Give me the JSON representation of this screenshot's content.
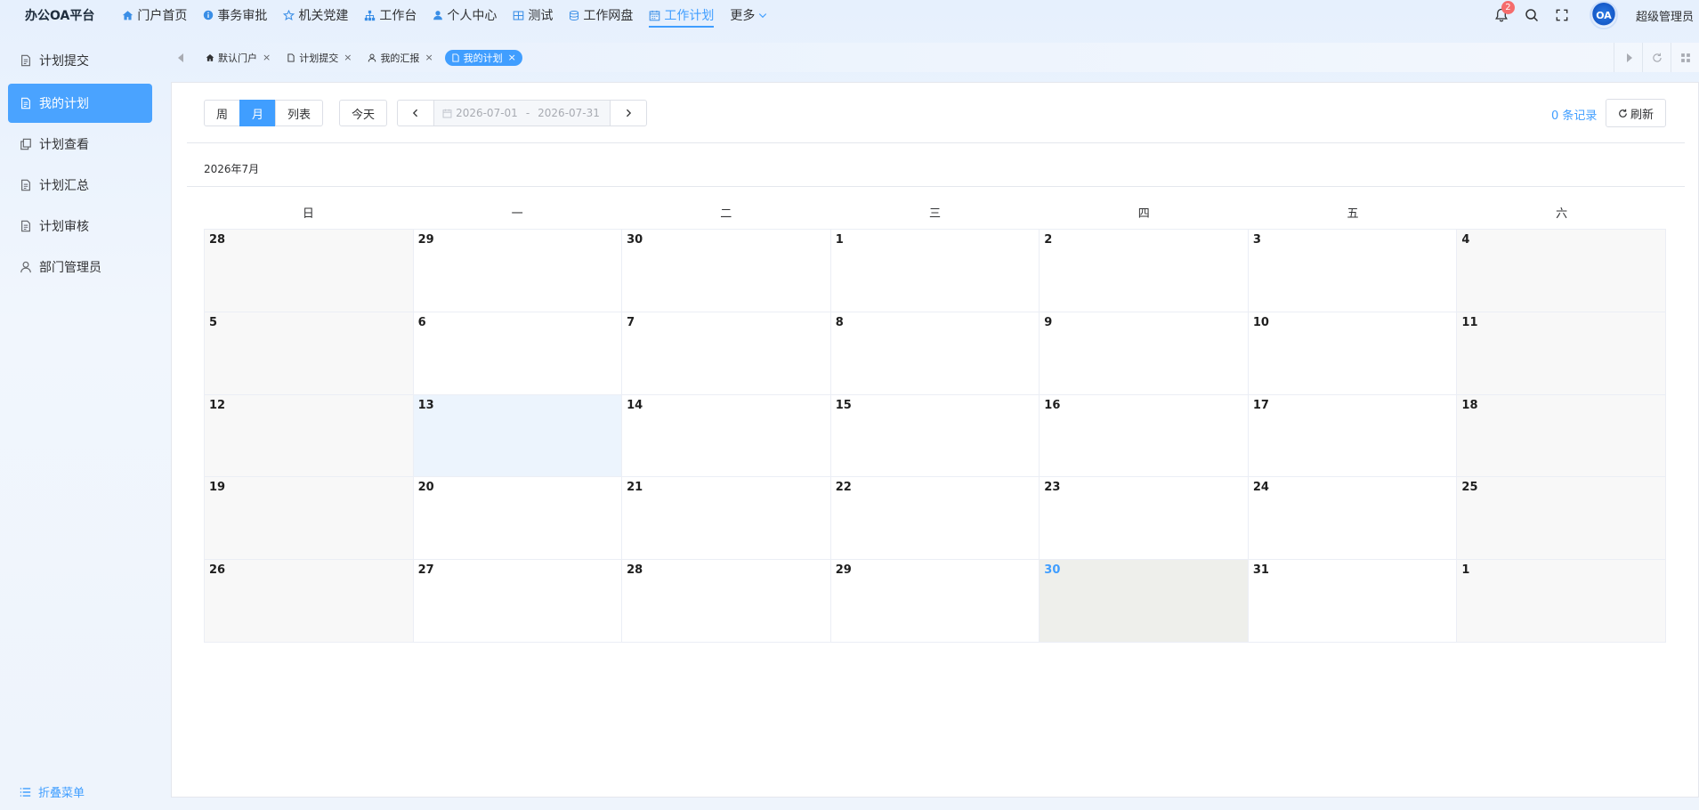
{
  "app": {
    "title": "办公OA平台"
  },
  "topnav": [
    {
      "label": "门户首页",
      "icon": "home-icon"
    },
    {
      "label": "事务审批",
      "icon": "info-icon"
    },
    {
      "label": "机关党建",
      "icon": "star-icon"
    },
    {
      "label": "工作台",
      "icon": "org-icon"
    },
    {
      "label": "个人中心",
      "icon": "user-icon"
    },
    {
      "label": "测试",
      "icon": "grid-icon"
    },
    {
      "label": "工作网盘",
      "icon": "database-icon"
    },
    {
      "label": "工作计划",
      "icon": "calendar-icon",
      "active": true
    },
    {
      "label": "更多",
      "icon": "chevron-down-icon"
    }
  ],
  "header": {
    "notification_count": "2",
    "avatar_text": "OA",
    "username": "超级管理员"
  },
  "sidebar": {
    "items": [
      {
        "label": "计划提交",
        "icon": "document-icon"
      },
      {
        "label": "我的计划",
        "icon": "document-icon",
        "active": true
      },
      {
        "label": "计划查看",
        "icon": "copy-document-icon"
      },
      {
        "label": "计划汇总",
        "icon": "document-icon"
      },
      {
        "label": "计划审核",
        "icon": "document-icon"
      },
      {
        "label": "部门管理员",
        "icon": "user-icon"
      }
    ],
    "collapse_label": "折叠菜单"
  },
  "tabs": [
    {
      "label": "默认门户",
      "icon": "home-icon"
    },
    {
      "label": "计划提交",
      "icon": "document-icon"
    },
    {
      "label": "我的汇报",
      "icon": "user-icon"
    },
    {
      "label": "我的计划",
      "icon": "document-icon",
      "active": true
    }
  ],
  "toolbar": {
    "views": [
      {
        "label": "周"
      },
      {
        "label": "月",
        "active": true
      },
      {
        "label": "列表"
      }
    ],
    "today_label": "今天",
    "date_start": "2026-07-01",
    "date_sep": "-",
    "date_end": "2026-07-31",
    "record_count": "0 条记录",
    "refresh_label": "刷新"
  },
  "calendar": {
    "month_title": "2026年7月",
    "weekdays": [
      "日",
      "一",
      "二",
      "三",
      "四",
      "五",
      "六"
    ],
    "days": [
      "28",
      "29",
      "30",
      "1",
      "2",
      "3",
      "4",
      "5",
      "6",
      "7",
      "8",
      "9",
      "10",
      "11",
      "12",
      "13",
      "14",
      "15",
      "16",
      "17",
      "18",
      "19",
      "20",
      "21",
      "22",
      "23",
      "24",
      "25",
      "26",
      "27",
      "28",
      "29",
      "30",
      "31",
      "1"
    ],
    "selected_index": 15,
    "today_index": 32
  },
  "colors": {
    "accent": "#409eff",
    "sidebar_active": "#4aa3ff",
    "badge": "#f56c6c",
    "today_bg": "#eeefeb",
    "selected_bg": "#ecf4fd"
  }
}
